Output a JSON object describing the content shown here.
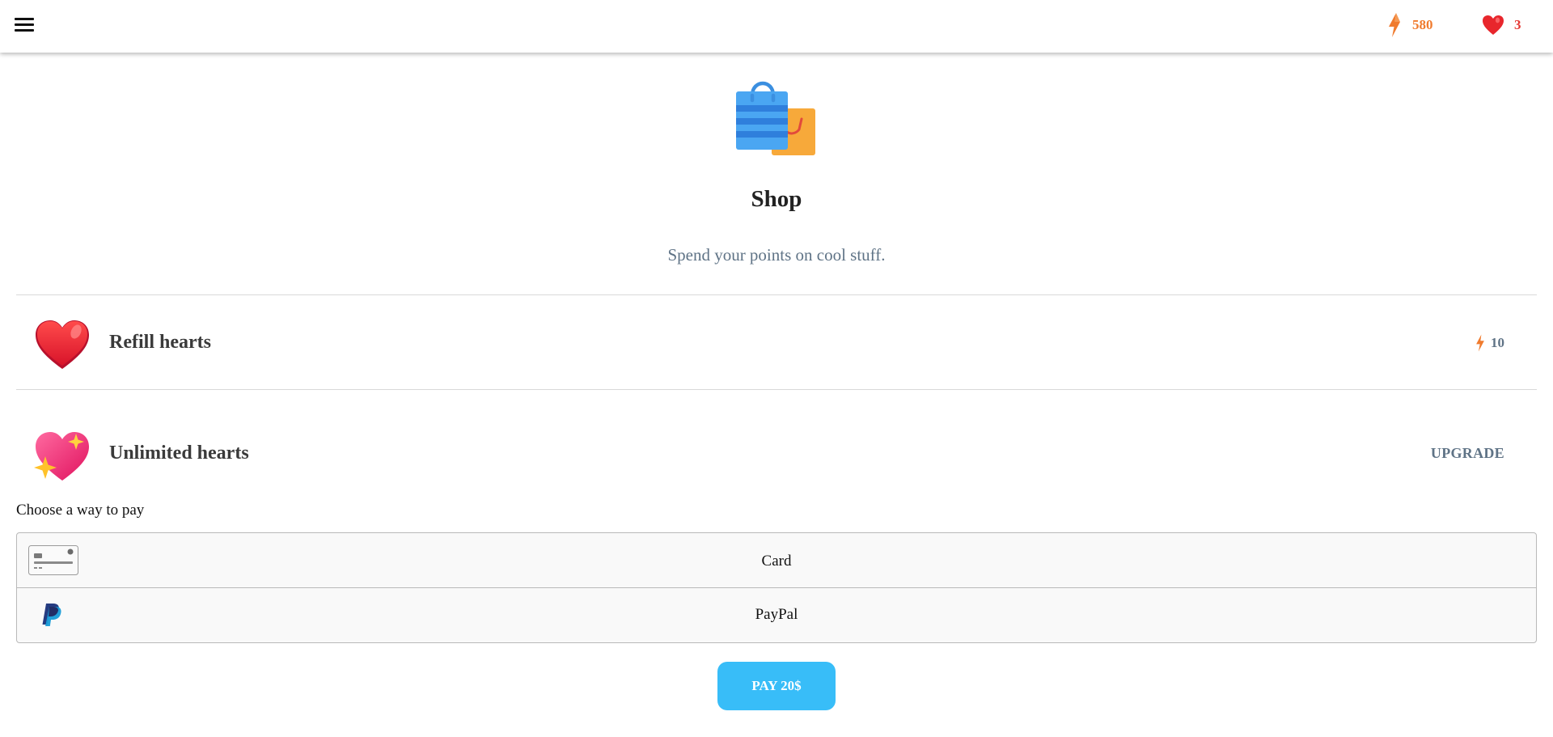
{
  "header": {
    "menu_icon": "hamburger-menu-icon",
    "points": "580",
    "points_icon": "lightning-bolt-icon",
    "hearts": "3",
    "hearts_icon": "heart-icon"
  },
  "shop": {
    "icon": "shopping-bags-icon",
    "title": "Shop",
    "subtitle": "Spend your points on cool stuff."
  },
  "items": [
    {
      "label": "Refill hearts",
      "icon": "heart-icon",
      "price": "10",
      "price_icon": "lightning-bolt-icon"
    },
    {
      "label": "Unlimited hearts",
      "icon": "sparkling-heart-icon",
      "action": "UPGRADE"
    }
  ],
  "payment": {
    "heading": "Choose a way to pay",
    "options": [
      {
        "label": "Card",
        "icon": "credit-card-icon"
      },
      {
        "label": "PayPal",
        "icon": "paypal-icon"
      }
    ],
    "pay_button": "PAY 20$"
  },
  "colors": {
    "points": "#f07b2e",
    "hearts": "#e53935",
    "muted_text": "#5f7386",
    "pay_button": "#38bdf8"
  }
}
